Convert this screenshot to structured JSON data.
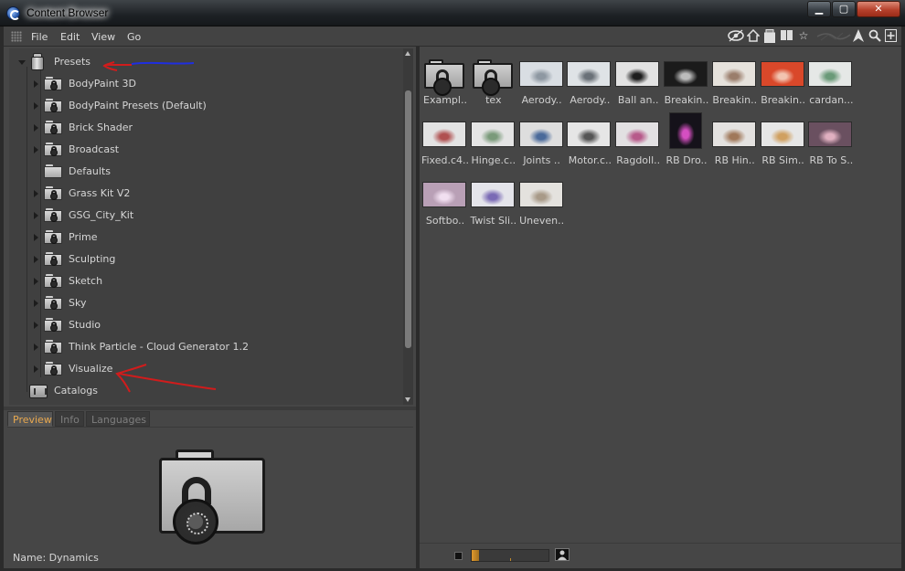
{
  "window": {
    "title": "Content Browser"
  },
  "menu": {
    "items": [
      {
        "label": "File"
      },
      {
        "label": "Edit"
      },
      {
        "label": "View"
      },
      {
        "label": "Go"
      }
    ]
  },
  "tree": {
    "root": {
      "label": "Presets"
    },
    "children": [
      {
        "label": "BodyPaint 3D",
        "expandable": true
      },
      {
        "label": "BodyPaint Presets (Default)",
        "expandable": true
      },
      {
        "label": "Brick Shader",
        "expandable": true
      },
      {
        "label": "Broadcast",
        "expandable": true
      },
      {
        "label": "Defaults",
        "expandable": false
      },
      {
        "label": "Grass Kit V2",
        "expandable": true
      },
      {
        "label": "GSG_City_Kit",
        "expandable": true
      },
      {
        "label": "Prime",
        "expandable": true
      },
      {
        "label": "Sculpting",
        "expandable": true
      },
      {
        "label": "Sketch",
        "expandable": true
      },
      {
        "label": "Sky",
        "expandable": true
      },
      {
        "label": "Studio",
        "expandable": true
      },
      {
        "label": "Think Particle - Cloud Generator 1.2",
        "expandable": true
      },
      {
        "label": "Visualize",
        "expandable": true
      }
    ],
    "catalogs": {
      "label": "Catalogs"
    }
  },
  "tabs": [
    {
      "label": "Preview",
      "active": true
    },
    {
      "label": "Info",
      "active": false
    },
    {
      "label": "Languages",
      "active": false
    }
  ],
  "preview": {
    "name_label": "Name:",
    "name_value": "Dynamics"
  },
  "grid": {
    "items": [
      {
        "caption": "Exampl..",
        "kind": "folder"
      },
      {
        "caption": "tex",
        "kind": "folder"
      },
      {
        "caption": "Aerody..",
        "kind": "scene",
        "bg": "#d9dee3",
        "fg": "#8e98a2"
      },
      {
        "caption": "Aerody..",
        "kind": "scene",
        "bg": "#dfe3e6",
        "fg": "#6a7178"
      },
      {
        "caption": "Ball an..",
        "kind": "scene",
        "bg": "#e2e2e2",
        "fg": "#1e1e1e"
      },
      {
        "caption": "Breakin..",
        "kind": "scene",
        "bg": "#1b1b1b",
        "fg": "#bdbdbd"
      },
      {
        "caption": "Breakin..",
        "kind": "scene",
        "bg": "#e6e2dc",
        "fg": "#9a7d6b"
      },
      {
        "caption": "Breakin..",
        "kind": "scene",
        "bg": "#d9482a",
        "fg": "#f2c4b0"
      },
      {
        "caption": "cardan...",
        "kind": "scene",
        "bg": "#e5e8e6",
        "fg": "#6a9a78"
      },
      {
        "caption": "Fixed.c4..",
        "kind": "scene",
        "bg": "#e3e3e3",
        "fg": "#b05050"
      },
      {
        "caption": "Hinge.c..",
        "kind": "scene",
        "bg": "#e4e4e4",
        "fg": "#7a9a7a"
      },
      {
        "caption": "Joints ..",
        "kind": "scene",
        "bg": "#dedede",
        "fg": "#4a6a9a"
      },
      {
        "caption": "Motor.c..",
        "kind": "scene",
        "bg": "#e6e6e6",
        "fg": "#555555"
      },
      {
        "caption": "Ragdoll..",
        "kind": "scene",
        "bg": "#e2e0e2",
        "fg": "#b75a8a"
      },
      {
        "caption": "RB Dro..",
        "kind": "scene",
        "bg": "#15121a",
        "fg": "#d54fc1"
      },
      {
        "caption": "RB Hin..",
        "kind": "scene",
        "bg": "#e4e2e0",
        "fg": "#a0785a"
      },
      {
        "caption": "RB Sim..",
        "kind": "scene",
        "bg": "#e6e6e6",
        "fg": "#d0a060"
      },
      {
        "caption": "RB To S..",
        "kind": "scene",
        "bg": "#6a5060",
        "fg": "#e0b0c0"
      },
      {
        "caption": "Softbo..",
        "kind": "scene",
        "bg": "#b9a0b6",
        "fg": "#f1dff0"
      },
      {
        "caption": "Twist Sli..",
        "kind": "scene",
        "bg": "#e4e4ea",
        "fg": "#7a6ab5"
      },
      {
        "caption": "Uneven..",
        "kind": "scene",
        "bg": "#e4e2de",
        "fg": "#a89a88"
      }
    ]
  },
  "colors": {
    "accent": "#e8a84f",
    "annotation_red": "#d01c1c",
    "annotation_blue": "#1f2ee0"
  },
  "icons": {
    "toolbar": [
      "eye-icon",
      "home-icon",
      "presets-icon",
      "book-icon",
      "star-icon",
      "arrow-icon",
      "search-icon",
      "add-icon"
    ]
  }
}
